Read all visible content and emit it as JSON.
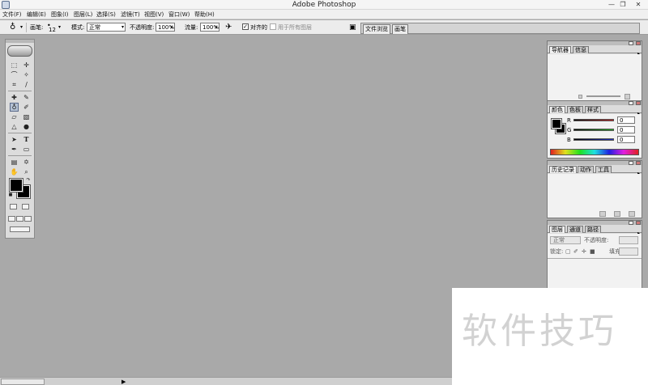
{
  "window": {
    "title": "Adobe Photoshop",
    "minimize_glyph": "—",
    "maximize_glyph": "❐",
    "close_glyph": "✕"
  },
  "menu": [
    {
      "label": "文件(F)"
    },
    {
      "label": "编辑(E)"
    },
    {
      "label": "图象(I)"
    },
    {
      "label": "图层(L)"
    },
    {
      "label": "选择(S)"
    },
    {
      "label": "滤镜(T)"
    },
    {
      "label": "视图(V)"
    },
    {
      "label": "窗口(W)"
    },
    {
      "label": "帮助(H)"
    }
  ],
  "options": {
    "brush_label": "画笔:",
    "brush_size": "12",
    "mode_label": "模式:",
    "mode_value": "正常",
    "opacity_label": "不透明度:",
    "opacity_value": "100%",
    "flow_label": "流量:",
    "flow_value": "100%",
    "aligned_label": "对齐的",
    "aligned_checked": true,
    "all_layers_label": "用于所有图层",
    "all_layers_checked": false
  },
  "palette_well": {
    "tabs": [
      "文件浏览",
      "画笔"
    ]
  },
  "toolbox": {
    "foreground_color": "#000000",
    "background_color": "#000000",
    "tools": [
      {
        "name": "marquee-tool-icon",
        "glyph": "⬚"
      },
      {
        "name": "move-tool-icon",
        "glyph": "✛"
      },
      {
        "name": "lasso-tool-icon",
        "glyph": "⌒"
      },
      {
        "name": "magic-wand-tool-icon",
        "glyph": "✧"
      },
      {
        "name": "crop-tool-icon",
        "glyph": "⌗"
      },
      {
        "name": "slice-tool-icon",
        "glyph": "∕"
      },
      {
        "name": "healing-brush-tool-icon",
        "glyph": "✚"
      },
      {
        "name": "brush-tool-icon",
        "glyph": "✎"
      },
      {
        "name": "clone-stamp-tool-icon",
        "glyph": "♁"
      },
      {
        "name": "history-brush-tool-icon",
        "glyph": "✐"
      },
      {
        "name": "eraser-tool-icon",
        "glyph": "▱"
      },
      {
        "name": "gradient-tool-icon",
        "glyph": "▧"
      },
      {
        "name": "blur-tool-icon",
        "glyph": "△"
      },
      {
        "name": "dodge-tool-icon",
        "glyph": "●"
      },
      {
        "name": "path-selection-tool-icon",
        "glyph": "➤"
      },
      {
        "name": "type-tool-icon",
        "glyph": "T"
      },
      {
        "name": "pen-tool-icon",
        "glyph": "✒"
      },
      {
        "name": "shape-tool-icon",
        "glyph": "▭"
      },
      {
        "name": "notes-tool-icon",
        "glyph": "▤"
      },
      {
        "name": "eyedropper-tool-icon",
        "glyph": "✡"
      },
      {
        "name": "hand-tool-icon",
        "glyph": "✋"
      },
      {
        "name": "zoom-tool-icon",
        "glyph": "⌕"
      }
    ]
  },
  "navigator": {
    "tabs": [
      "导航器",
      "信息"
    ]
  },
  "color": {
    "tabs": [
      "颜色",
      "色板",
      "样式"
    ],
    "foreground": "#000000",
    "background": "#000000",
    "channels": [
      {
        "label": "R",
        "value": "0",
        "color": "#b02020"
      },
      {
        "label": "G",
        "value": "0",
        "color": "#20a020"
      },
      {
        "label": "B",
        "value": "0",
        "color": "#2030b0"
      }
    ]
  },
  "history": {
    "tabs": [
      "历史记录",
      "动作",
      "工具"
    ]
  },
  "layers": {
    "tabs": [
      "图层",
      "通道",
      "路径"
    ],
    "mode_value": "正常",
    "opacity_label": "不透明度:",
    "lock_label": "锁定:",
    "fill_label": "填充:"
  },
  "watermark": {
    "text": "软件技巧"
  }
}
